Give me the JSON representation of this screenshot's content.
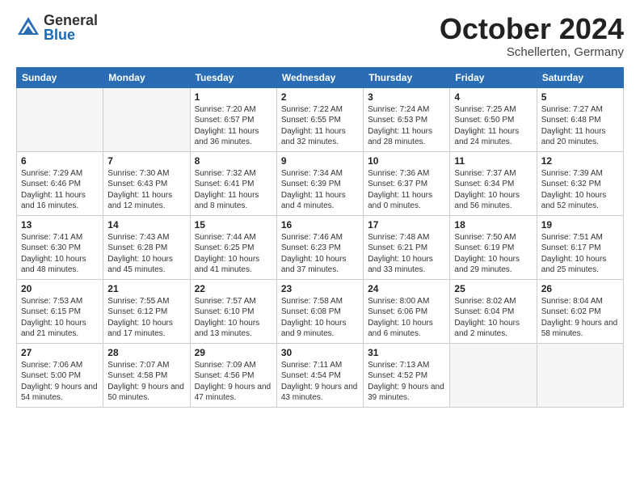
{
  "logo": {
    "general": "General",
    "blue": "Blue"
  },
  "title": "October 2024",
  "location": "Schellerten, Germany",
  "days_of_week": [
    "Sunday",
    "Monday",
    "Tuesday",
    "Wednesday",
    "Thursday",
    "Friday",
    "Saturday"
  ],
  "weeks": [
    [
      {
        "day": "",
        "info": ""
      },
      {
        "day": "",
        "info": ""
      },
      {
        "day": "1",
        "info": "Sunrise: 7:20 AM\nSunset: 6:57 PM\nDaylight: 11 hours and 36 minutes."
      },
      {
        "day": "2",
        "info": "Sunrise: 7:22 AM\nSunset: 6:55 PM\nDaylight: 11 hours and 32 minutes."
      },
      {
        "day": "3",
        "info": "Sunrise: 7:24 AM\nSunset: 6:53 PM\nDaylight: 11 hours and 28 minutes."
      },
      {
        "day": "4",
        "info": "Sunrise: 7:25 AM\nSunset: 6:50 PM\nDaylight: 11 hours and 24 minutes."
      },
      {
        "day": "5",
        "info": "Sunrise: 7:27 AM\nSunset: 6:48 PM\nDaylight: 11 hours and 20 minutes."
      }
    ],
    [
      {
        "day": "6",
        "info": "Sunrise: 7:29 AM\nSunset: 6:46 PM\nDaylight: 11 hours and 16 minutes."
      },
      {
        "day": "7",
        "info": "Sunrise: 7:30 AM\nSunset: 6:43 PM\nDaylight: 11 hours and 12 minutes."
      },
      {
        "day": "8",
        "info": "Sunrise: 7:32 AM\nSunset: 6:41 PM\nDaylight: 11 hours and 8 minutes."
      },
      {
        "day": "9",
        "info": "Sunrise: 7:34 AM\nSunset: 6:39 PM\nDaylight: 11 hours and 4 minutes."
      },
      {
        "day": "10",
        "info": "Sunrise: 7:36 AM\nSunset: 6:37 PM\nDaylight: 11 hours and 0 minutes."
      },
      {
        "day": "11",
        "info": "Sunrise: 7:37 AM\nSunset: 6:34 PM\nDaylight: 10 hours and 56 minutes."
      },
      {
        "day": "12",
        "info": "Sunrise: 7:39 AM\nSunset: 6:32 PM\nDaylight: 10 hours and 52 minutes."
      }
    ],
    [
      {
        "day": "13",
        "info": "Sunrise: 7:41 AM\nSunset: 6:30 PM\nDaylight: 10 hours and 48 minutes."
      },
      {
        "day": "14",
        "info": "Sunrise: 7:43 AM\nSunset: 6:28 PM\nDaylight: 10 hours and 45 minutes."
      },
      {
        "day": "15",
        "info": "Sunrise: 7:44 AM\nSunset: 6:25 PM\nDaylight: 10 hours and 41 minutes."
      },
      {
        "day": "16",
        "info": "Sunrise: 7:46 AM\nSunset: 6:23 PM\nDaylight: 10 hours and 37 minutes."
      },
      {
        "day": "17",
        "info": "Sunrise: 7:48 AM\nSunset: 6:21 PM\nDaylight: 10 hours and 33 minutes."
      },
      {
        "day": "18",
        "info": "Sunrise: 7:50 AM\nSunset: 6:19 PM\nDaylight: 10 hours and 29 minutes."
      },
      {
        "day": "19",
        "info": "Sunrise: 7:51 AM\nSunset: 6:17 PM\nDaylight: 10 hours and 25 minutes."
      }
    ],
    [
      {
        "day": "20",
        "info": "Sunrise: 7:53 AM\nSunset: 6:15 PM\nDaylight: 10 hours and 21 minutes."
      },
      {
        "day": "21",
        "info": "Sunrise: 7:55 AM\nSunset: 6:12 PM\nDaylight: 10 hours and 17 minutes."
      },
      {
        "day": "22",
        "info": "Sunrise: 7:57 AM\nSunset: 6:10 PM\nDaylight: 10 hours and 13 minutes."
      },
      {
        "day": "23",
        "info": "Sunrise: 7:58 AM\nSunset: 6:08 PM\nDaylight: 10 hours and 9 minutes."
      },
      {
        "day": "24",
        "info": "Sunrise: 8:00 AM\nSunset: 6:06 PM\nDaylight: 10 hours and 6 minutes."
      },
      {
        "day": "25",
        "info": "Sunrise: 8:02 AM\nSunset: 6:04 PM\nDaylight: 10 hours and 2 minutes."
      },
      {
        "day": "26",
        "info": "Sunrise: 8:04 AM\nSunset: 6:02 PM\nDaylight: 9 hours and 58 minutes."
      }
    ],
    [
      {
        "day": "27",
        "info": "Sunrise: 7:06 AM\nSunset: 5:00 PM\nDaylight: 9 hours and 54 minutes."
      },
      {
        "day": "28",
        "info": "Sunrise: 7:07 AM\nSunset: 4:58 PM\nDaylight: 9 hours and 50 minutes."
      },
      {
        "day": "29",
        "info": "Sunrise: 7:09 AM\nSunset: 4:56 PM\nDaylight: 9 hours and 47 minutes."
      },
      {
        "day": "30",
        "info": "Sunrise: 7:11 AM\nSunset: 4:54 PM\nDaylight: 9 hours and 43 minutes."
      },
      {
        "day": "31",
        "info": "Sunrise: 7:13 AM\nSunset: 4:52 PM\nDaylight: 9 hours and 39 minutes."
      },
      {
        "day": "",
        "info": ""
      },
      {
        "day": "",
        "info": ""
      }
    ]
  ]
}
